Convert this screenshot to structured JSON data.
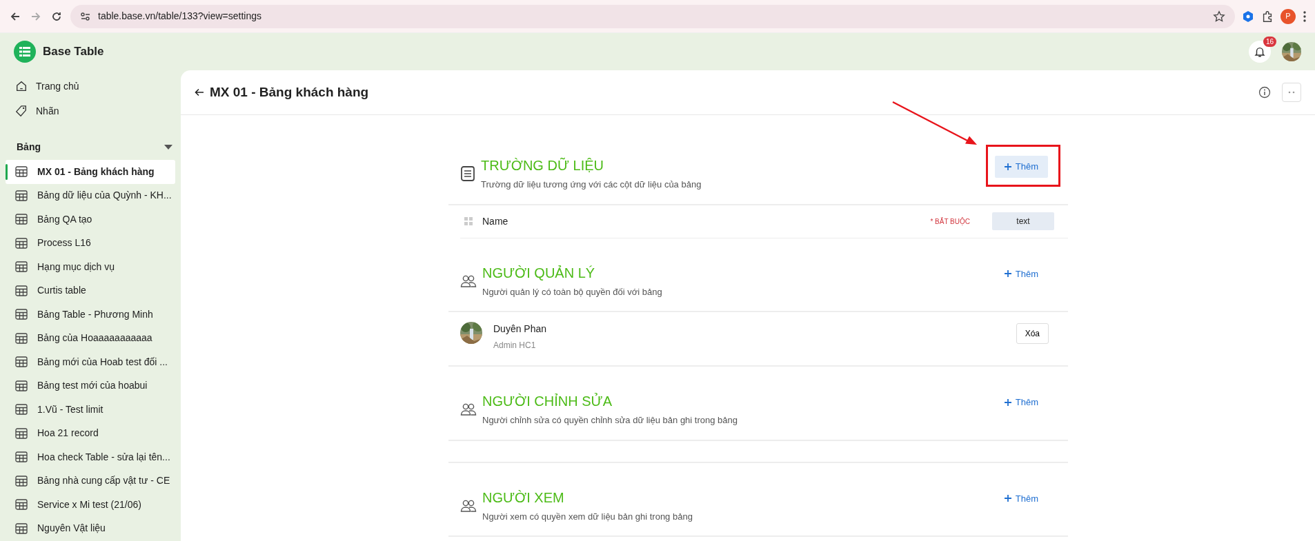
{
  "browser": {
    "url": "table.base.vn/table/133?view=settings",
    "profile_initial": "P"
  },
  "app": {
    "name": "Base Table",
    "notification_count": "16"
  },
  "sidebar": {
    "items": [
      {
        "label": "Trang chủ"
      },
      {
        "label": "Nhãn"
      }
    ],
    "section_title": "Bảng",
    "expanded": true,
    "tables": [
      {
        "label": "MX 01 - Bảng khách hàng",
        "selected": true
      },
      {
        "label": "Bảng dữ liệu của Quỳnh - KH...",
        "selected": false
      },
      {
        "label": "Bảng QA tạo",
        "selected": false
      },
      {
        "label": "Process L16",
        "selected": false
      },
      {
        "label": "Hạng mục dịch vụ",
        "selected": false
      },
      {
        "label": "Curtis table",
        "selected": false
      },
      {
        "label": "Bảng Table - Phương Minh",
        "selected": false
      },
      {
        "label": "Bảng của Hoaaaaaaaaaaa",
        "selected": false
      },
      {
        "label": "Bảng mới của Hoab test đối ...",
        "selected": false
      },
      {
        "label": "Bảng test mới của hoabui",
        "selected": false
      },
      {
        "label": "1.Vũ - Test limit",
        "selected": false
      },
      {
        "label": "Hoa 21 record",
        "selected": false
      },
      {
        "label": "Hoa check Table - sửa lại tên...",
        "selected": false
      },
      {
        "label": "Bảng nhà cung cấp vật tư - CE",
        "selected": false
      },
      {
        "label": "Service x Mi test (21/06)",
        "selected": false
      },
      {
        "label": "Nguyên Vật liệu",
        "selected": false
      }
    ]
  },
  "page": {
    "title": "MX 01 - Bảng khách hàng"
  },
  "sections": [
    {
      "title": "TRƯỜNG DỮ LIỆU",
      "description": "Trường dữ liệu tương ứng với các cột dữ liệu của bảng",
      "add_label": "Thêm",
      "highlighted": true,
      "annotated": true,
      "fields": [
        {
          "name": "Name",
          "required_label": "* BẮT BUỘC",
          "type": "text"
        }
      ]
    },
    {
      "title": "NGƯỜI QUẢN LÝ",
      "description": "Người quản lý có toàn bộ quyền đối với bảng",
      "add_label": "Thêm",
      "highlighted": false,
      "annotated": false,
      "members": [
        {
          "name": "Duyên Phan",
          "role": "Admin HC1",
          "action": "Xóa"
        }
      ]
    },
    {
      "title": "NGƯỜI CHỈNH SỬA",
      "description": "Người chỉnh sửa có quyền chỉnh sửa dữ liệu bản ghi trong bảng",
      "add_label": "Thêm",
      "highlighted": false,
      "annotated": false
    },
    {
      "title": "NGƯỜI XEM",
      "description": "Người xem có quyền xem dữ liệu bản ghi trong bảng",
      "add_label": "Thêm",
      "highlighted": false,
      "annotated": false
    }
  ]
}
